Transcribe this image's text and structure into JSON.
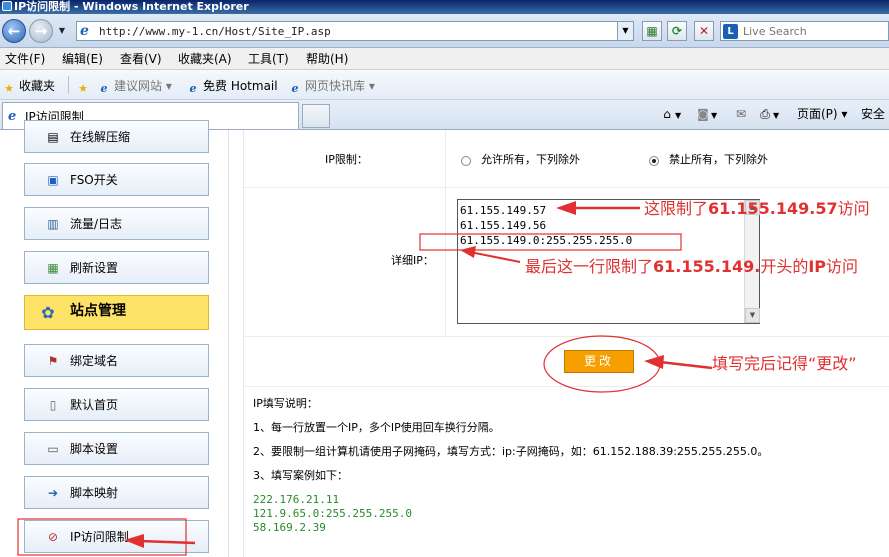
{
  "window": {
    "title": "IP访问限制 - Windows Internet Explorer"
  },
  "address_bar": {
    "url": "http://www.my-1.cn/Host/Site_IP.asp",
    "search_placeholder": "Live Search"
  },
  "menu": {
    "items": [
      "文件(F)",
      "编辑(E)",
      "查看(V)",
      "收藏夹(A)",
      "工具(T)",
      "帮助(H)"
    ]
  },
  "favorites_bar": {
    "favorites_label": "收藏夹",
    "links": [
      "建议网站 ▾",
      "免费 Hotmail",
      "网页快讯库 ▾"
    ]
  },
  "tab": {
    "label": "IP访问限制",
    "page_menu": "页面(P) ▾",
    "safety_menu": "安全"
  },
  "sidebar": {
    "items": [
      {
        "label": "在线解压缩",
        "icon": "archive-icon"
      },
      {
        "label": "FSO开关",
        "icon": "switch-icon"
      },
      {
        "label": "流量/日志",
        "icon": "chart-icon"
      },
      {
        "label": "刷新设置",
        "icon": "refresh-grid-icon"
      },
      {
        "label": "站点管理",
        "icon": "site-manage-icon",
        "active": true
      },
      {
        "label": "绑定域名",
        "icon": "stamp-icon"
      },
      {
        "label": "默认首页",
        "icon": "page-icon"
      },
      {
        "label": "脚本设置",
        "icon": "script-icon"
      },
      {
        "label": "脚本映射",
        "icon": "mapping-icon"
      },
      {
        "label": "IP访问限制",
        "icon": "ip-restrict-icon"
      }
    ]
  },
  "form": {
    "ip_limit_label": "IP限制：",
    "option_allow": "允许所有，下列除外",
    "option_deny": "禁止所有，下列除外",
    "selected_option": "deny",
    "detail_label": "详细IP：",
    "ip_list": "61.155.149.57\n61.155.149.56\n61.155.149.0:255.255.255.0",
    "submit_label": "更改"
  },
  "help": {
    "title": "IP填写说明：",
    "line1": "1、每一行放置一个IP，多个IP使用回车换行分隔。",
    "line2": "2、要限制一组计算机请使用子网掩码，填写方式：ip:子网掩码，如：61.152.188.39:255.255.255.0。",
    "line3": "3、填写案例如下：",
    "examples": [
      "222.176.21.11",
      "121.9.65.0:255.255.255.0",
      "58.169.2.39"
    ]
  },
  "annotations": {
    "note1_prefix": "这限制了",
    "note1_ip": "61.155.149.57",
    "note1_suffix": "访问",
    "note2_prefix": "最后这一行限制了",
    "note2_ip": "61.155.149.",
    "note2_mid": "开头的",
    "note2_ip_word": "IP",
    "note2_suffix": "访问",
    "note3": "填写完后记得“更改”"
  },
  "colors": {
    "annotation_red": "#e03030",
    "submit_orange": "#f5a000",
    "active_sidebar": "#fde268",
    "example_green": "#2a8a2a"
  }
}
